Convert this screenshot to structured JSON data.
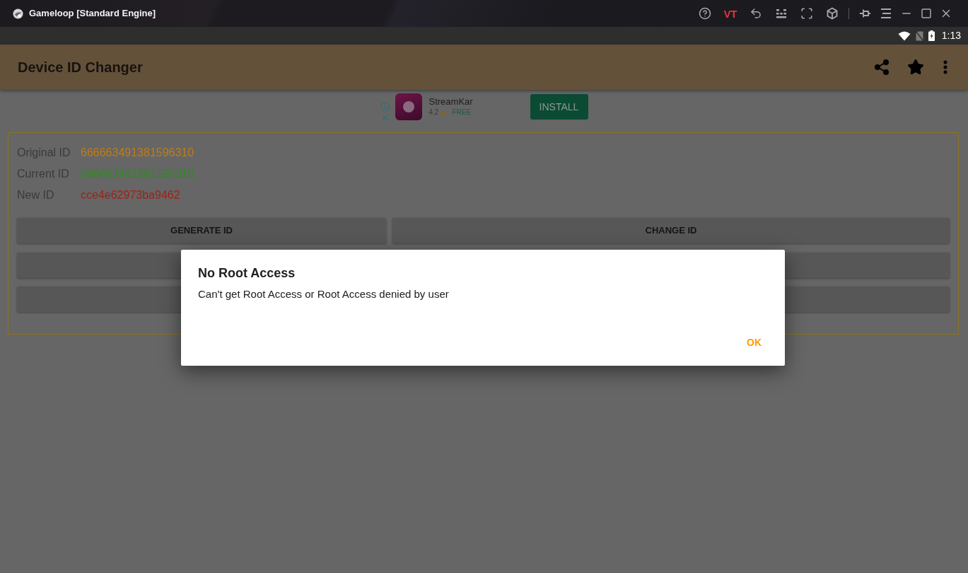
{
  "window": {
    "title": "Gameloop [Standard Engine]",
    "badge": "VT"
  },
  "status_bar": {
    "time": "1:13"
  },
  "app_bar": {
    "title": "Device ID Changer"
  },
  "ad": {
    "app_name": "StreamKar",
    "rating": "4.2",
    "price": "FREE",
    "button": "INSTALL"
  },
  "ids": [
    {
      "label": "Original ID",
      "value": "666663491381596310",
      "color": "#c07c14"
    },
    {
      "label": "Current ID",
      "value": "666663491381596310",
      "color": "#2f8a22"
    },
    {
      "label": "New ID",
      "value": "cce4e62973ba9462",
      "color": "#9e2217"
    }
  ],
  "buttons": [
    "GENERATE ID",
    "CHANGE ID"
  ],
  "dialog": {
    "title": "No Root Access",
    "message": "Can't get Root Access or Root Access denied by user",
    "button": "OK"
  }
}
